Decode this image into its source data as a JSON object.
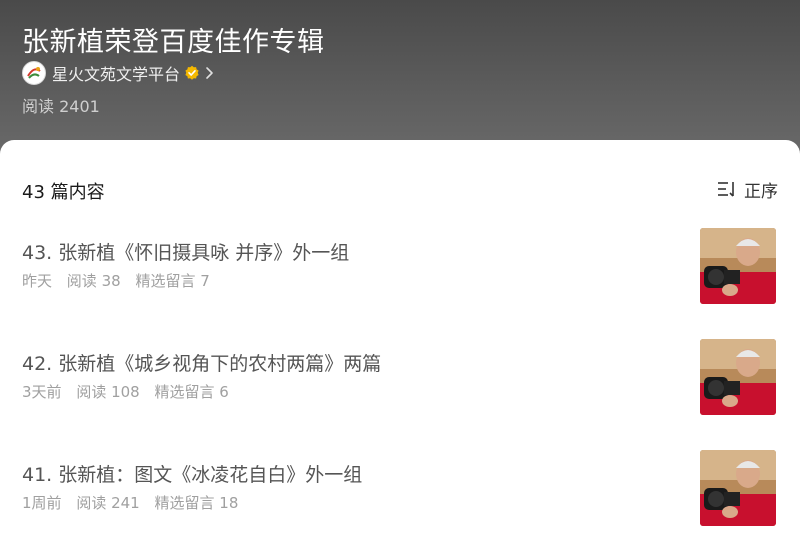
{
  "header": {
    "title": "张新植荣登百度佳作专辑",
    "author": {
      "name": "星火文苑文学平台",
      "avatar_icon": "platform-logo",
      "verified_icon": "verified-badge-icon",
      "verified_color": "#f5b800"
    },
    "read_count": "阅读 2401"
  },
  "list": {
    "count_label": "43 篇内容",
    "sort": {
      "icon": "sort-icon",
      "label": "正序"
    },
    "articles": [
      {
        "title": "43. 张新植《怀旧摄具咏 并序》外一组",
        "date": "昨天",
        "reads": "阅读 38",
        "comments": "精选留言 7"
      },
      {
        "title": "42. 张新植《城乡视角下的农村两篇》两篇",
        "date": "3天前",
        "reads": "阅读 108",
        "comments": "精选留言 6"
      },
      {
        "title": "41. 张新植：图文《冰凌花自白》外一组",
        "date": "1周前",
        "reads": "阅读 241",
        "comments": "精选留言 18"
      }
    ]
  },
  "colors": {
    "header_bg": "#555555",
    "thumb_red": "#c8102e",
    "meta_text": "#a0a0a0"
  }
}
